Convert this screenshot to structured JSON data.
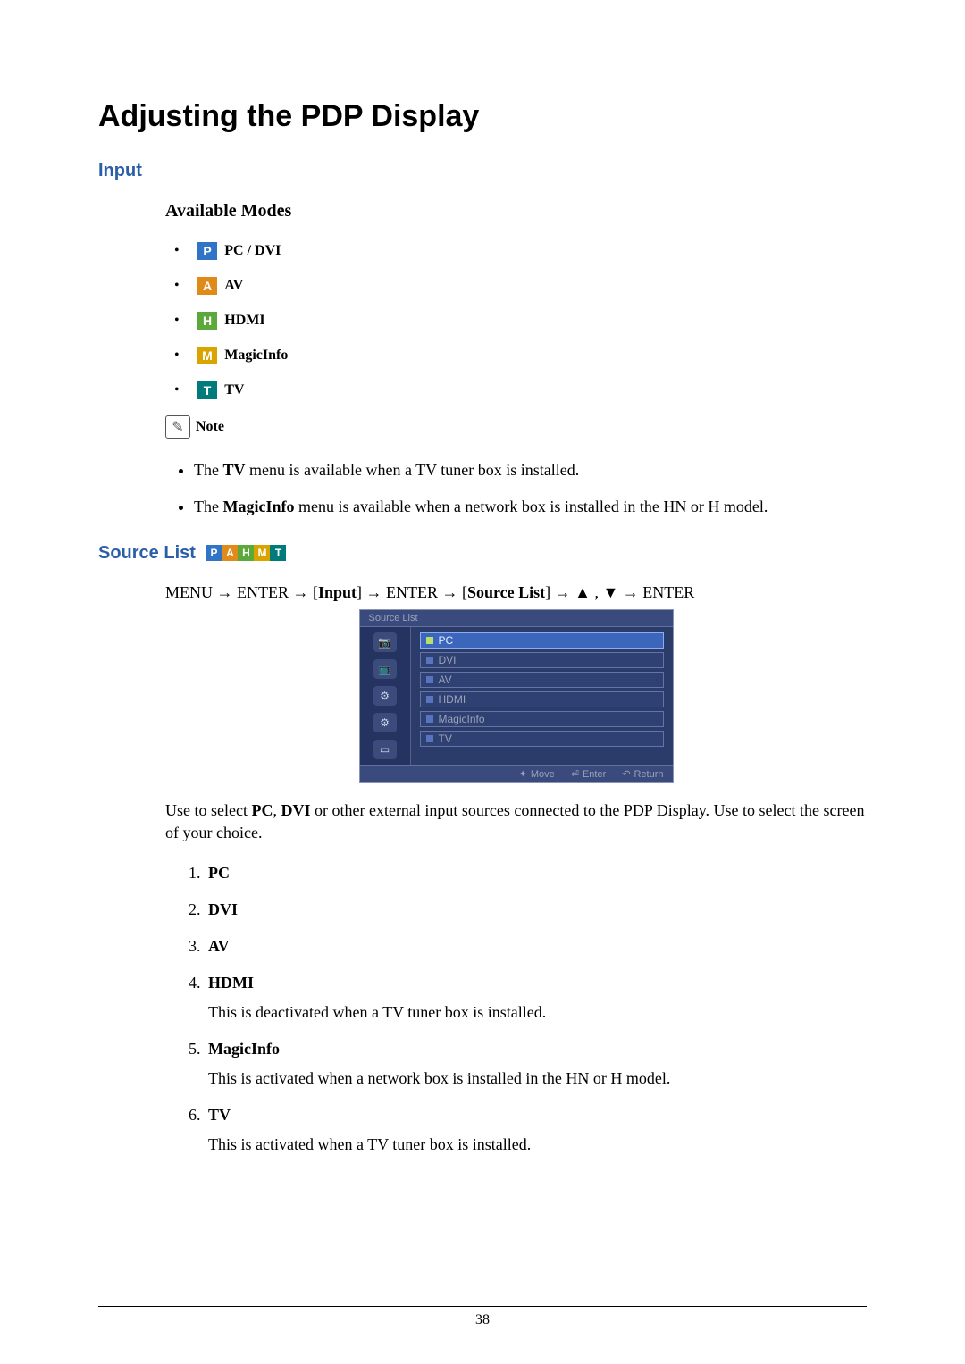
{
  "title": "Adjusting the PDP Display",
  "input_heading": "Input",
  "available_modes_heading": "Available Modes",
  "modes": [
    {
      "chip_letter": "P",
      "chip_class": "chip-p",
      "label": "PC / DVI",
      "name": "mode-pc-dvi"
    },
    {
      "chip_letter": "A",
      "chip_class": "chip-a",
      "label": "AV",
      "name": "mode-av"
    },
    {
      "chip_letter": "H",
      "chip_class": "chip-h",
      "label": "HDMI",
      "name": "mode-hdmi"
    },
    {
      "chip_letter": "M",
      "chip_class": "chip-m",
      "label": "MagicInfo",
      "name": "mode-magicinfo"
    },
    {
      "chip_letter": "T",
      "chip_class": "chip-t",
      "label": "TV",
      "name": "mode-tv"
    }
  ],
  "note_label": "Note",
  "note_items": {
    "tv_prefix": "The ",
    "tv_bold": "TV",
    "tv_suffix": " menu is available when a TV tuner box is installed.",
    "mi_prefix": "The ",
    "mi_bold": "MagicInfo",
    "mi_suffix": " menu is available when a network box is installed in the HN or H model."
  },
  "source_list_heading": "Source List",
  "source_strip": [
    "P",
    "A",
    "H",
    "M",
    "T"
  ],
  "path": {
    "p1": "MENU → ENTER → [",
    "b1": "Input",
    "p2": "] → ENTER → [",
    "b2": "Source List",
    "p3": "] → ▲ , ▼ → ENTER"
  },
  "screenshot": {
    "title": "Source List",
    "items": [
      {
        "label": "PC",
        "active": true
      },
      {
        "label": "DVI",
        "active": false
      },
      {
        "label": "AV",
        "active": false
      },
      {
        "label": "HDMI",
        "active": false
      },
      {
        "label": "MagicInfo",
        "active": false
      },
      {
        "label": "TV",
        "active": false
      }
    ],
    "side_icons": [
      "📷",
      "📺",
      "⚙",
      "⚙",
      "▭"
    ],
    "footer": {
      "move": "Move",
      "enter": "Enter",
      "return": "Return"
    }
  },
  "usage_desc": {
    "p1": "Use to select ",
    "b1": "PC",
    "p2": ", ",
    "b2": "DVI",
    "p3": " or other external input sources connected to the PDP Display. Use to select the screen of your choice."
  },
  "source_options": [
    {
      "name": "PC",
      "desc": ""
    },
    {
      "name": "DVI",
      "desc": ""
    },
    {
      "name": "AV",
      "desc": ""
    },
    {
      "name": "HDMI",
      "desc": "This is deactivated when a TV tuner box is installed."
    },
    {
      "name": "MagicInfo",
      "desc": "This is activated when a network box is installed in the HN or H model."
    },
    {
      "name": "TV",
      "desc": "This is activated when a TV tuner box is installed."
    }
  ],
  "page_number": "38"
}
